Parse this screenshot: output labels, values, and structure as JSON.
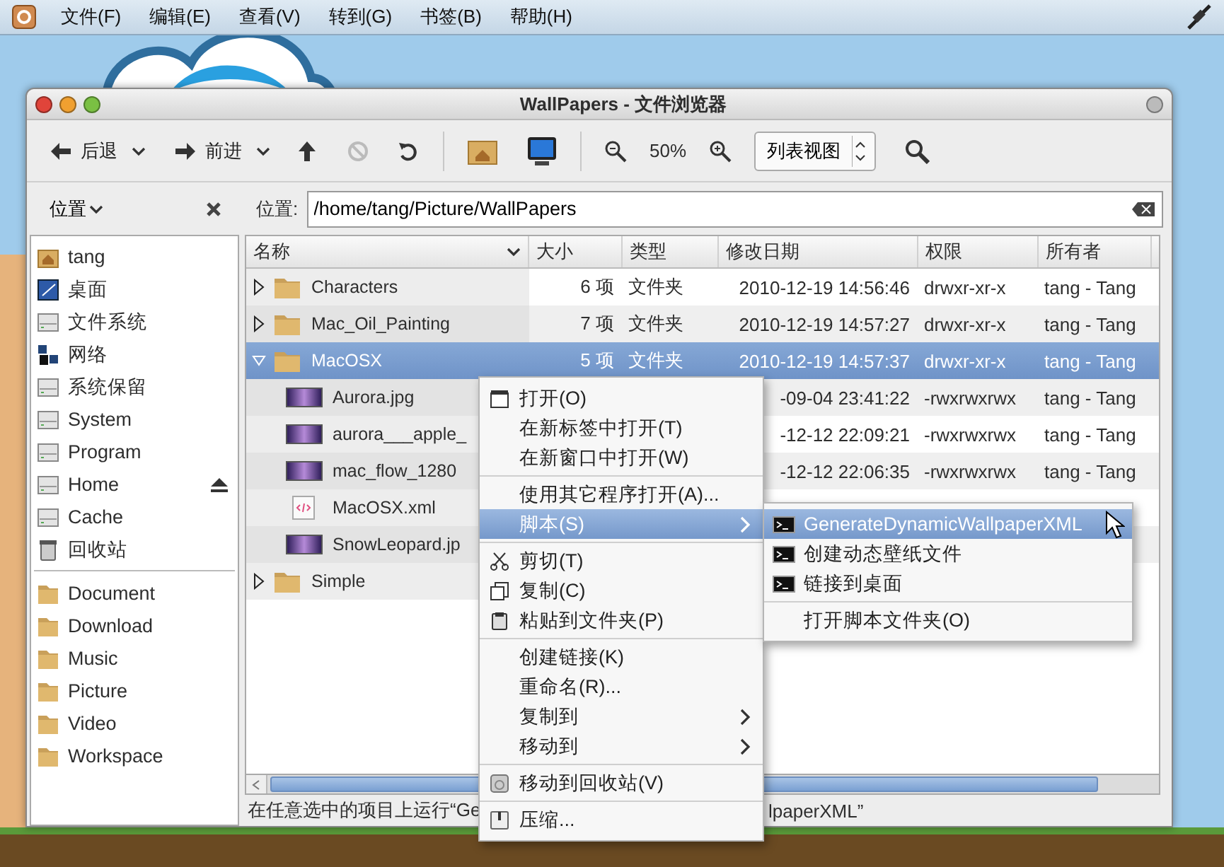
{
  "top_panel": {
    "menus": [
      "文件(F)",
      "编辑(E)",
      "查看(V)",
      "转到(G)",
      "书签(B)",
      "帮助(H)"
    ]
  },
  "window": {
    "title": "WallPapers - 文件浏览器"
  },
  "toolbar": {
    "back": "后退",
    "forward": "前进",
    "stop": {
      "disabled": true
    },
    "zoom": "50%",
    "view_select": "列表视图"
  },
  "sidebar": {
    "title": "位置",
    "places": [
      {
        "label": "tang",
        "kind": "home",
        "ejectable": false
      },
      {
        "label": "桌面",
        "kind": "desktop",
        "ejectable": false
      },
      {
        "label": "文件系统",
        "kind": "drive",
        "ejectable": false
      },
      {
        "label": "网络",
        "kind": "network",
        "ejectable": false
      },
      {
        "label": "系统保留",
        "kind": "drive",
        "ejectable": false
      },
      {
        "label": "System",
        "kind": "drive",
        "ejectable": false
      },
      {
        "label": "Program",
        "kind": "drive",
        "ejectable": false
      },
      {
        "label": "Home",
        "kind": "drive",
        "ejectable": true
      },
      {
        "label": "Cache",
        "kind": "drive",
        "ejectable": false
      },
      {
        "label": "回收站",
        "kind": "trash",
        "ejectable": false
      }
    ],
    "bookmarks": [
      "Document",
      "Download",
      "Music",
      "Picture",
      "Video",
      "Workspace"
    ]
  },
  "location": {
    "label": "位置:",
    "path": "/home/tang/Picture/WallPapers"
  },
  "table": {
    "columns": [
      "名称",
      "大小",
      "类型",
      "修改日期",
      "权限",
      "所有者"
    ],
    "rows": [
      {
        "kind": "folder",
        "name": "Characters",
        "size": "6 项",
        "type": "文件夹",
        "date": "2010-12-19 14:56:46",
        "perms": "drwxr-xr-x",
        "owner": "tang - Tang",
        "expanded": false,
        "selected": false
      },
      {
        "kind": "folder",
        "name": "Mac_Oil_Painting",
        "size": "7 项",
        "type": "文件夹",
        "date": "2010-12-19 14:57:27",
        "perms": "drwxr-xr-x",
        "owner": "tang - Tang",
        "expanded": false,
        "selected": false
      },
      {
        "kind": "folder",
        "name": "MacOSX",
        "size": "5 项",
        "type": "文件夹",
        "date": "2010-12-19 14:57:37",
        "perms": "drwxr-xr-x",
        "owner": "tang - Tang",
        "expanded": true,
        "selected": true,
        "children": [
          {
            "kind": "image",
            "name": "Aurora.jpg",
            "date": "-09-04 23:41:22",
            "perms": "-rwxrwxrwx",
            "owner": "tang - Tang",
            "selected": false
          },
          {
            "kind": "image",
            "name": "aurora___apple_",
            "date": "-12-12 22:09:21",
            "perms": "-rwxrwxrwx",
            "owner": "tang - Tang",
            "selected": false
          },
          {
            "kind": "image",
            "name": "mac_flow_1280",
            "date": "-12-12 22:06:35",
            "perms": "-rwxrwxrwx",
            "owner": "tang - Tang",
            "selected": false
          },
          {
            "kind": "xml",
            "name": "MacOSX.xml",
            "selected": false
          },
          {
            "kind": "image",
            "name": "SnowLeopard.jp",
            "selected": false
          }
        ]
      },
      {
        "kind": "folder",
        "name": "Simple",
        "expanded": false,
        "selected": false
      }
    ]
  },
  "status_bar": {
    "text": "在任意选中的项目上运行“Ge",
    "text_after_menu": "lpaperXML”"
  },
  "context_menu": {
    "groups": [
      [
        {
          "label": "打开(O)",
          "kind": "open",
          "submenu": false,
          "selected": false
        },
        {
          "label": "在新标签中打开(T)",
          "submenu": false,
          "selected": false
        },
        {
          "label": "在新窗口中打开(W)",
          "submenu": false,
          "selected": false
        }
      ],
      [
        {
          "label": "使用其它程序打开(A)...",
          "submenu": false,
          "selected": false
        },
        {
          "label": "脚本(S)",
          "submenu": true,
          "selected": true
        }
      ],
      [
        {
          "label": "剪切(T)",
          "kind": "cut",
          "submenu": false,
          "selected": false
        },
        {
          "label": "复制(C)",
          "kind": "copy",
          "submenu": false,
          "selected": false
        },
        {
          "label": "粘贴到文件夹(P)",
          "kind": "paste",
          "submenu": false,
          "selected": false
        }
      ],
      [
        {
          "label": "创建链接(K)",
          "submenu": false,
          "selected": false
        },
        {
          "label": "重命名(R)...",
          "submenu": false,
          "selected": false
        },
        {
          "label": "复制到",
          "submenu": true,
          "selected": false
        },
        {
          "label": "移动到",
          "submenu": true,
          "selected": false
        }
      ],
      [
        {
          "label": "移动到回收站(V)",
          "kind": "trash",
          "submenu": false,
          "selected": false
        }
      ],
      [
        {
          "label": "压缩...",
          "kind": "archive",
          "submenu": false,
          "selected": false
        }
      ]
    ]
  },
  "submenu": {
    "groups": [
      [
        {
          "label": "GenerateDynamicWallpaperXML",
          "kind": "script",
          "selected": true
        },
        {
          "label": "创建动态壁纸文件",
          "kind": "script",
          "selected": false
        },
        {
          "label": "链接到桌面",
          "kind": "script",
          "selected": false
        }
      ],
      [
        {
          "label": "打开脚本文件夹(O)",
          "selected": false
        }
      ]
    ]
  }
}
